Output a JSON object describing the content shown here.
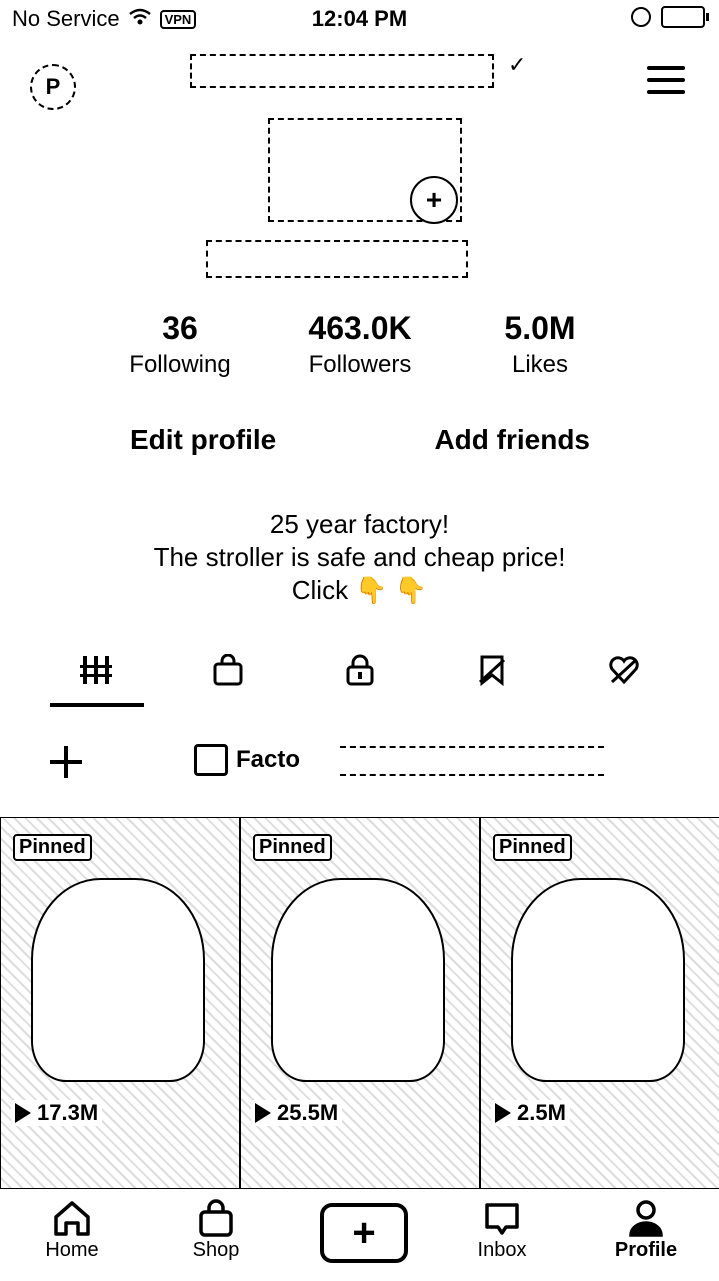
{
  "status_bar": {
    "carrier": "No Service",
    "vpn": "VPN",
    "time": "12:04 PM"
  },
  "header": {
    "badge_letter": "P",
    "verified_mark": "✓"
  },
  "stats": [
    {
      "value": "36",
      "label": "Following"
    },
    {
      "value": "463.0K",
      "label": "Followers"
    },
    {
      "value": "5.0M",
      "label": "Likes"
    }
  ],
  "actions": {
    "edit_profile": "Edit profile",
    "add_friends": "Add friends"
  },
  "bio": {
    "line1": "25 year factory!",
    "line2": "The stroller is safe and cheap price!",
    "line3": "Click 👇 👇"
  },
  "tabs": [
    "videos-icon",
    "shop-bag-icon",
    "private-lock-icon",
    "favorites-icon",
    "liked-icon"
  ],
  "playlist": {
    "chip_label": "Facto"
  },
  "videos": [
    {
      "pinned": "Pinned",
      "views": "17.3M"
    },
    {
      "pinned": "Pinned",
      "views": "25.5M"
    },
    {
      "pinned": "Pinned",
      "views": "2.5M"
    }
  ],
  "bottom_nav": {
    "home": "Home",
    "shop": "Shop",
    "create": "+",
    "inbox": "Inbox",
    "profile": "Profile"
  }
}
